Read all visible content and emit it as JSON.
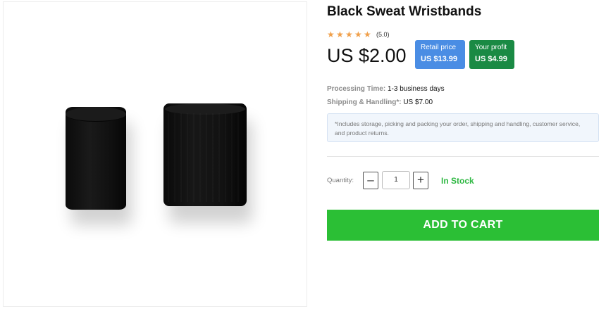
{
  "product": {
    "title": "Black Sweat Wristbands",
    "rating_stars": 5,
    "rating_text": "(5.0)",
    "price": "US $2.00",
    "image_alt": "wristbands-image"
  },
  "tags": {
    "retail_label": "Retail price",
    "retail_value": "US $13.99",
    "retail_color": "#4a8de4",
    "profit_label": "Your profit",
    "profit_value": "US $4.99",
    "profit_color": "#1a8a44"
  },
  "info": {
    "processing_key": "Processing Time:",
    "processing_value": "1-3 business days",
    "shipping_key": "Shipping & Handling*:",
    "shipping_value": "US $7.00"
  },
  "note": "*Includes storage, picking and packing your order, shipping and handling, customer service, and product returns.",
  "quantity": {
    "label": "Quantity:",
    "minus": "–",
    "value": "1",
    "plus": "+"
  },
  "stock": "In Stock",
  "cart_button": "ADD TO CART",
  "colors": {
    "accent_green": "#2bbf35",
    "star": "#f0a04b"
  }
}
